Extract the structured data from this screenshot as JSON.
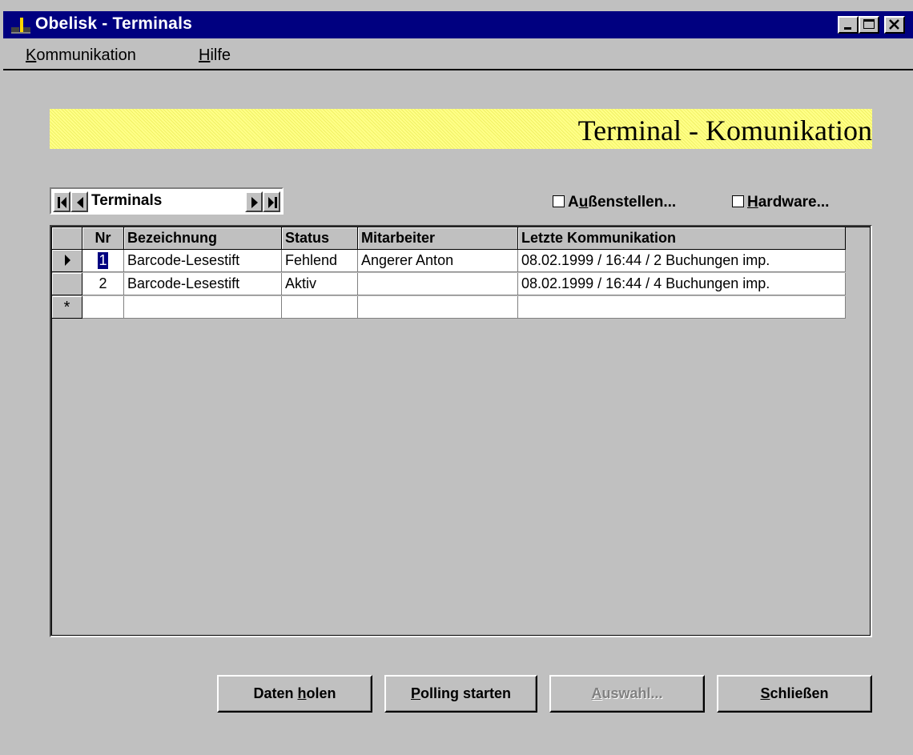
{
  "window": {
    "title": "Obelisk - Terminals",
    "icon": "obelisk-app-icon"
  },
  "menu": {
    "items": [
      {
        "mnemonic": "K",
        "rest": "ommunikation"
      },
      {
        "mnemonic": "H",
        "rest": "ilfe"
      }
    ]
  },
  "header": {
    "title": "Terminal - Komunikation",
    "band_color": "#ffff88"
  },
  "navigator": {
    "label": "Terminals"
  },
  "options": {
    "aussenstellen": {
      "pre": "A",
      "mnemonic": "u",
      "post": "ßenstellen...",
      "checked": false
    },
    "hardware": {
      "pre": "",
      "mnemonic": "H",
      "post": "ardware...",
      "checked": false
    }
  },
  "table": {
    "columns": [
      "Nr",
      "Bezeichnung",
      "Status",
      "Mitarbeiter",
      "Letzte Kommunikation"
    ],
    "rows": [
      {
        "selector": "current",
        "nr": "1",
        "bezeichnung": "Barcode-Lesestift",
        "status": "Fehlend",
        "mitarbeiter": "Angerer Anton",
        "letzte": "08.02.1999 / 16:44 / 2 Buchungen imp."
      },
      {
        "selector": "",
        "nr": "2",
        "bezeichnung": "Barcode-Lesestift",
        "status": "Aktiv",
        "mitarbeiter": "",
        "letzte": "08.02.1999 / 16:44 / 4 Buchungen imp."
      }
    ],
    "new_row_marker": "*"
  },
  "buttons": {
    "daten": {
      "pre": "Daten ",
      "mnemonic": "h",
      "post": "olen",
      "enabled": true
    },
    "polling": {
      "pre": "",
      "mnemonic": "P",
      "post": "olling starten",
      "enabled": true
    },
    "auswahl": {
      "pre": "",
      "mnemonic": "A",
      "post": "uswahl...",
      "enabled": false
    },
    "schliessen": {
      "pre": "",
      "mnemonic": "S",
      "post": "chließen",
      "enabled": true
    }
  },
  "colors": {
    "titlebar": "#000080",
    "face": "#c0c0c0",
    "disabled_text": "#808080"
  }
}
